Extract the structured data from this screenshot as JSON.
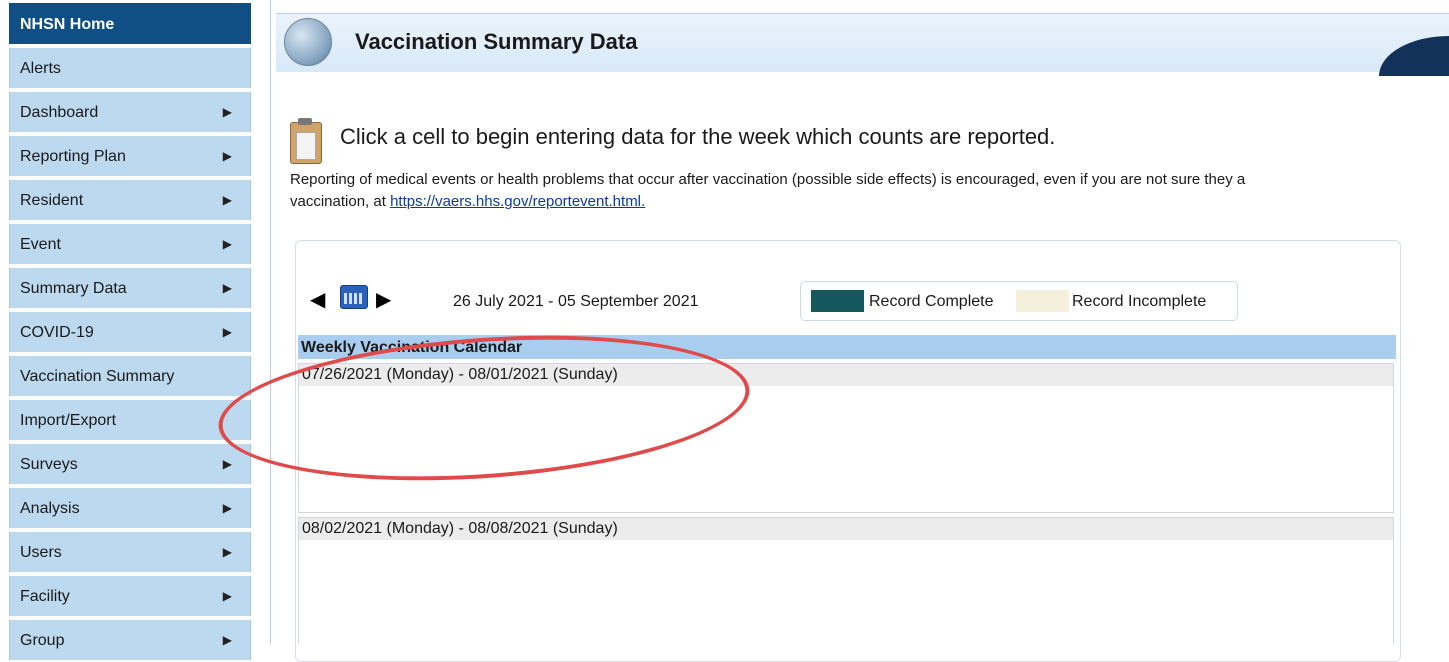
{
  "sidebar": {
    "items": [
      {
        "label": "NHSN Home",
        "has_arrow": false
      },
      {
        "label": "Alerts",
        "has_arrow": false
      },
      {
        "label": "Dashboard",
        "has_arrow": true
      },
      {
        "label": "Reporting Plan",
        "has_arrow": true
      },
      {
        "label": "Resident",
        "has_arrow": true
      },
      {
        "label": "Event",
        "has_arrow": true
      },
      {
        "label": "Summary Data",
        "has_arrow": true
      },
      {
        "label": "COVID-19",
        "has_arrow": true
      },
      {
        "label": "Vaccination Summary",
        "has_arrow": false
      },
      {
        "label": "Import/Export",
        "has_arrow": false
      },
      {
        "label": "Surveys",
        "has_arrow": true
      },
      {
        "label": "Analysis",
        "has_arrow": true
      },
      {
        "label": "Users",
        "has_arrow": true
      },
      {
        "label": "Facility",
        "has_arrow": true
      },
      {
        "label": "Group",
        "has_arrow": true
      }
    ]
  },
  "header": {
    "title": "Vaccination Summary Data"
  },
  "instruction": "Click a cell to begin entering data for the week which counts are reported.",
  "vaers": {
    "line1": "Reporting of medical events or health problems that occur after vaccination (possible side effects) is encouraged, even if you are not sure they a",
    "line2_prefix": "vaccination, at ",
    "link": "https://vaers.hhs.gov/reportevent.html."
  },
  "calendar": {
    "date_range": "26 July 2021  -  05 September 2021",
    "legend_complete": "Record Complete",
    "legend_incomplete": "Record Incomplete",
    "complete_color": "#14585e",
    "incomplete_color": "#f4f0dc",
    "title": "Weekly Vaccination Calendar",
    "weeks": [
      "07/26/2021 (Monday) - 08/01/2021 (Sunday)",
      "08/02/2021 (Monday) - 08/08/2021 (Sunday)"
    ]
  },
  "icons": {
    "prev": "triangle-left-icon",
    "calendar": "calendar-icon",
    "next": "triangle-right-icon",
    "nav_arrow": "triangle-right-icon",
    "clipboard": "clipboard-icon"
  }
}
